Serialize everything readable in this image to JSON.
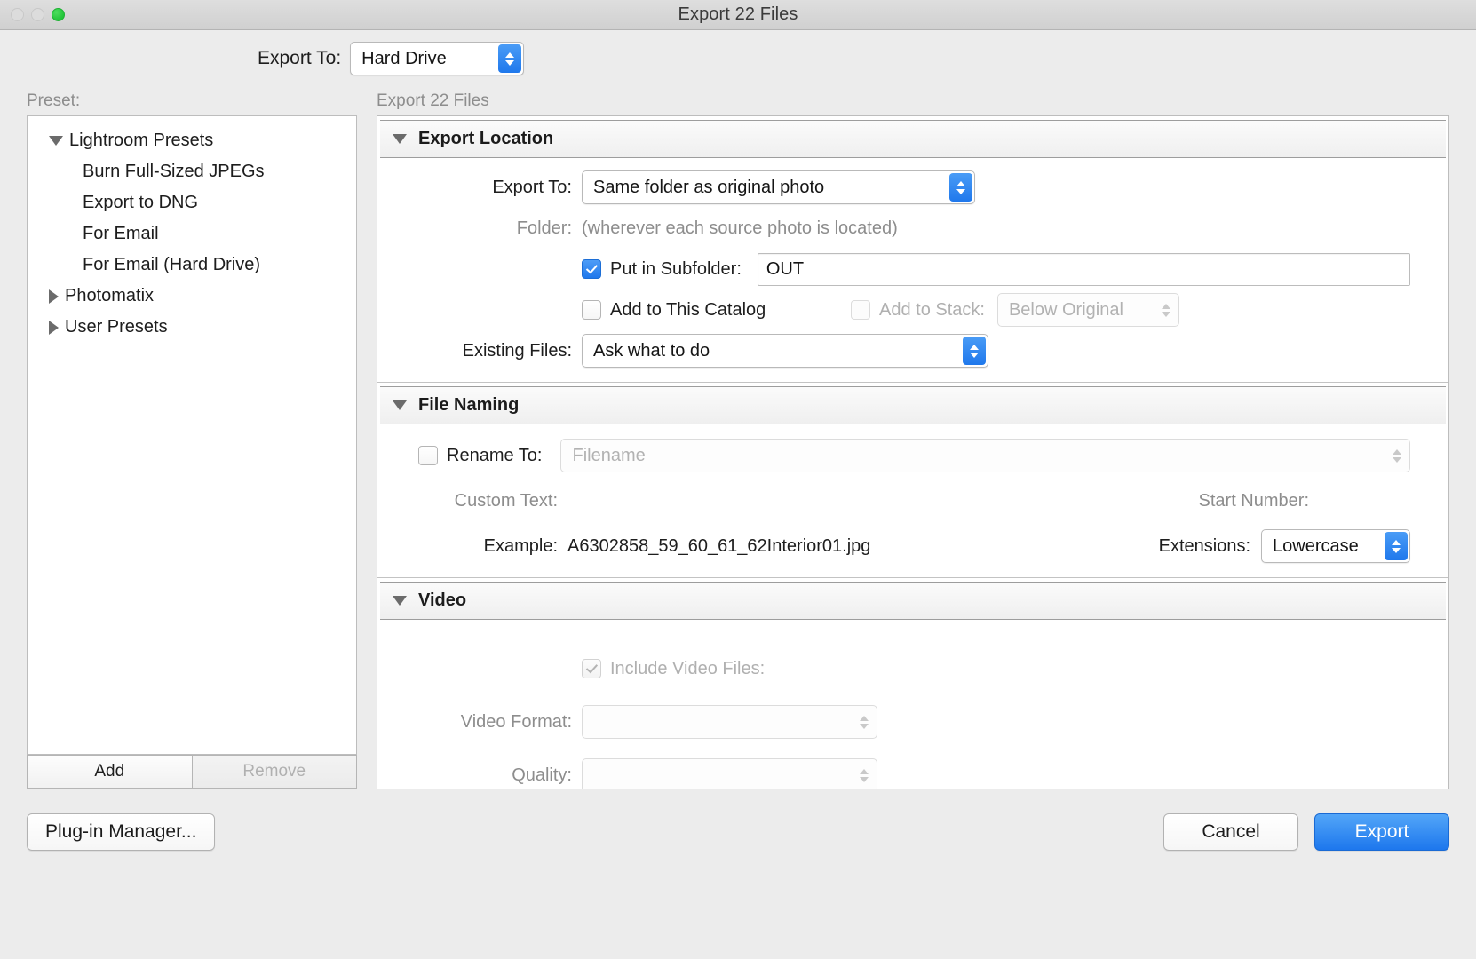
{
  "window": {
    "title": "Export 22 Files",
    "traffic_lights": [
      "close-dim",
      "minimize-dim",
      "zoom-green"
    ]
  },
  "top": {
    "export_to_label": "Export To:",
    "export_to_value": "Hard Drive"
  },
  "preset": {
    "label": "Preset:",
    "items": [
      {
        "label": "Lightroom Presets",
        "level": 0,
        "disclosure": "open"
      },
      {
        "label": "Burn Full-Sized JPEGs",
        "level": 1,
        "disclosure": "none"
      },
      {
        "label": "Export to DNG",
        "level": 1,
        "disclosure": "none"
      },
      {
        "label": "For Email",
        "level": 1,
        "disclosure": "none"
      },
      {
        "label": "For Email (Hard Drive)",
        "level": 1,
        "disclosure": "none"
      },
      {
        "label": "Photomatix",
        "level": 0,
        "disclosure": "closed"
      },
      {
        "label": "User Presets",
        "level": 0,
        "disclosure": "closed"
      }
    ],
    "add_label": "Add",
    "remove_label": "Remove"
  },
  "right_header": "Export 22 Files",
  "panels": {
    "export_location": {
      "title": "Export Location",
      "export_to_label": "Export To:",
      "export_to_value": "Same folder as original photo",
      "folder_label": "Folder:",
      "folder_value": "(wherever each source photo is located)",
      "put_in_subfolder_label": "Put in Subfolder:",
      "put_in_subfolder_checked": true,
      "subfolder_value": "OUT",
      "add_to_catalog_label": "Add to This Catalog",
      "add_to_catalog_checked": false,
      "add_to_stack_label": "Add to Stack:",
      "add_to_stack_checked": false,
      "add_to_stack_enabled": false,
      "stack_position_value": "Below Original",
      "existing_files_label": "Existing Files:",
      "existing_files_value": "Ask what to do"
    },
    "file_naming": {
      "title": "File Naming",
      "rename_to_label": "Rename To:",
      "rename_to_checked": false,
      "rename_to_value": "Filename",
      "custom_text_label": "Custom Text:",
      "custom_text_value": "",
      "start_number_label": "Start Number:",
      "start_number_value": "",
      "example_label": "Example:",
      "example_value": "A6302858_59_60_61_62Interior01.jpg",
      "extensions_label": "Extensions:",
      "extensions_value": "Lowercase"
    },
    "video": {
      "title": "Video",
      "include_video_label": "Include Video Files:",
      "include_video_checked": true,
      "include_video_enabled": false,
      "video_format_label": "Video Format:",
      "video_format_value": "",
      "quality_label": "Quality:",
      "quality_value": ""
    }
  },
  "footer": {
    "plugin_manager_label": "Plug-in Manager...",
    "cancel_label": "Cancel",
    "export_label": "Export"
  },
  "colors": {
    "accent": "#1f78ec",
    "window_bg": "#ececec",
    "muted_text": "#8d8d8d"
  }
}
